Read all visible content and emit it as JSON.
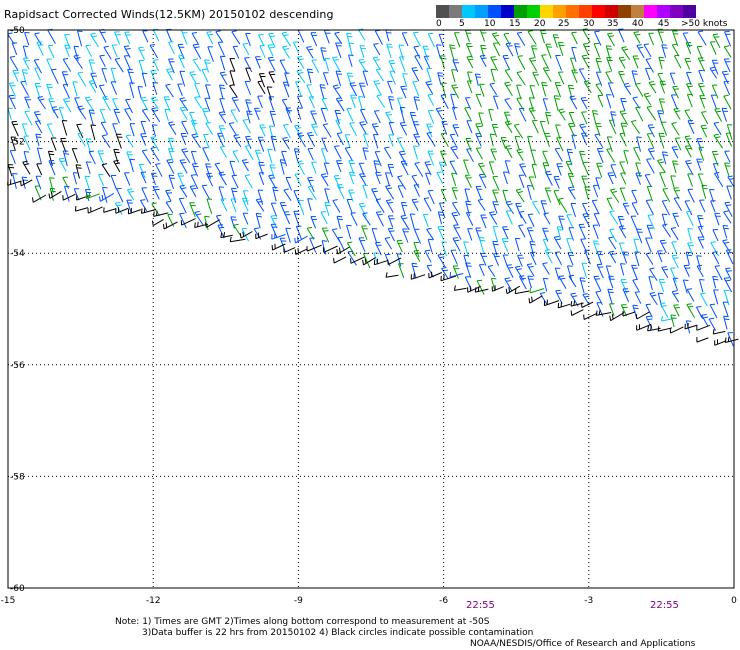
{
  "title": "Rapidsact Corrected Winds(12.5KM) 20150102 descending",
  "legend": {
    "labels": [
      "0",
      "5",
      "10",
      "15",
      "20",
      "25",
      "30",
      "35",
      "40",
      "45",
      ">50 knots"
    ],
    "colors": [
      "#505050",
      "#7a7a7a",
      "#00c8ff",
      "#00a0ff",
      "#0050ff",
      "#0000c8",
      "#00a000",
      "#00d000",
      "#ffd700",
      "#ffa000",
      "#ff7000",
      "#ff4000",
      "#ff0000",
      "#d00000",
      "#904000",
      "#c08040",
      "#ff00ff",
      "#b000ff",
      "#8000c0",
      "#5000a0"
    ]
  },
  "map": {
    "x_ticks": [
      "-15",
      "-12",
      "-9",
      "-6",
      "-3",
      "0"
    ],
    "y_ticks": [
      "-50",
      "-52",
      "-54",
      "-56",
      "-58",
      "-60"
    ],
    "lon_range": [
      -15,
      0
    ],
    "lat_range": [
      -60,
      -50
    ],
    "grid": true,
    "wind_colors": {
      "weak": "#00c8ff",
      "light": "#0050ff",
      "moderate": "#00a000",
      "flagged": "#000000"
    }
  },
  "times": [
    "22:55",
    "22:55"
  ],
  "notes": {
    "line1": "Note: 1) Times are GMT 2)Times along bottom correspond to measurement at -50S",
    "line2": "3)Data buffer is 22 hrs from 20150102 4) Black circles indicate possible contamination",
    "line3": "NOAA/NESDIS/Office of Research and Applications"
  }
}
